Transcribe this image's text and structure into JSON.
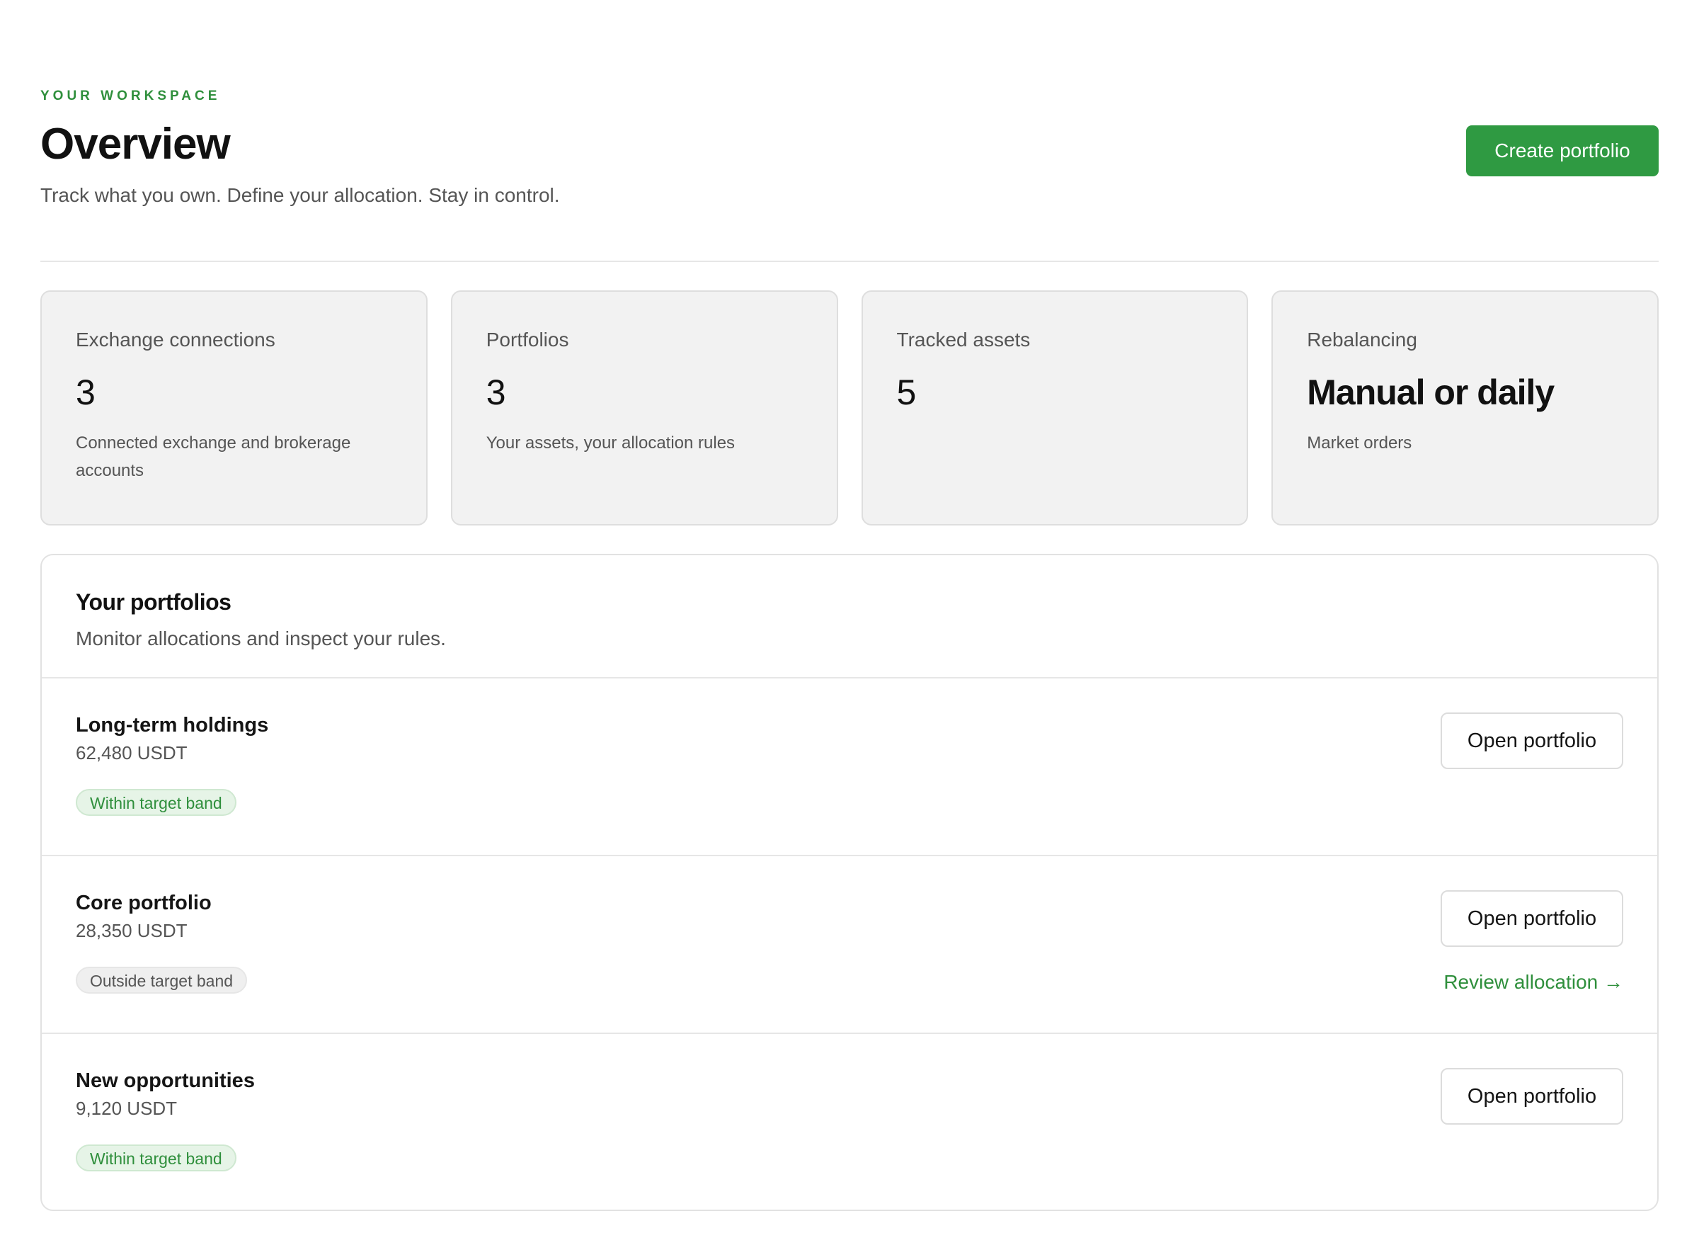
{
  "header": {
    "eyebrow": "YOUR WORKSPACE",
    "title": "Overview",
    "subtitle": "Track what you own. Define your allocation. Stay in control.",
    "create_label": "Create portfolio"
  },
  "stats": [
    {
      "label": "Exchange connections",
      "value": "3",
      "desc": "Connected exchange and brokerage accounts"
    },
    {
      "label": "Portfolios",
      "value": "3",
      "desc": "Your assets, your allocation rules"
    },
    {
      "label": "Tracked assets",
      "value": "5",
      "desc": ""
    },
    {
      "label": "Rebalancing",
      "value": "Manual or daily",
      "desc": "Market orders"
    }
  ],
  "portfolios": {
    "title": "Your portfolios",
    "subtitle": "Monitor allocations and inspect your rules.",
    "open_label": "Open portfolio",
    "review_label": "Review allocation →",
    "items": [
      {
        "name": "Long-term holdings",
        "amount": "62,480 USDT",
        "status": "Within target band"
      },
      {
        "name": "Core portfolio",
        "amount": "28,350 USDT",
        "status": "Outside target band"
      },
      {
        "name": "New opportunities",
        "amount": "9,120 USDT",
        "status": "Within target band"
      }
    ]
  },
  "colors": {
    "accent": "#2f9a42",
    "accent_text": "#2f8f3c",
    "card_bg": "#f2f2f2"
  }
}
